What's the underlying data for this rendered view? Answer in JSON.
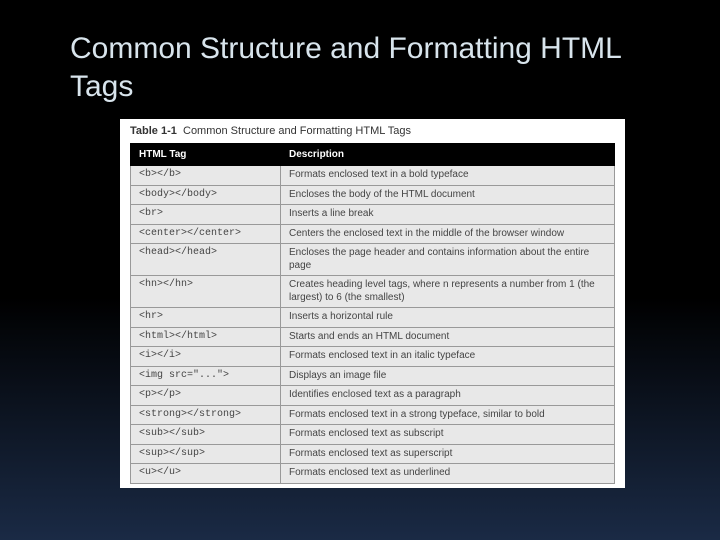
{
  "title": "Common Structure and Formatting HTML Tags",
  "caption": {
    "label": "Table 1-1",
    "text": "Common Structure and Formatting HTML Tags"
  },
  "headers": {
    "col1": "HTML Tag",
    "col2": "Description"
  },
  "rows": [
    {
      "tag": "<b></b>",
      "desc": "Formats enclosed text in a bold typeface"
    },
    {
      "tag": "<body></body>",
      "desc": "Encloses the body of the HTML document"
    },
    {
      "tag": "<br>",
      "desc": "Inserts a line break"
    },
    {
      "tag": "<center></center>",
      "desc": "Centers the enclosed text in the middle of the browser window"
    },
    {
      "tag": "<head></head>",
      "desc": "Encloses the page header and contains information about the entire page"
    },
    {
      "tag": "<hn></hn>",
      "desc": "Creates heading level tags, where n represents a number from 1 (the largest) to 6 (the smallest)"
    },
    {
      "tag": "<hr>",
      "desc": "Inserts a horizontal rule"
    },
    {
      "tag": "<html></html>",
      "desc": "Starts and ends an HTML document"
    },
    {
      "tag": "<i></i>",
      "desc": "Formats enclosed text in an italic typeface"
    },
    {
      "tag": "<img src=\"...\">",
      "desc": "Displays an image file"
    },
    {
      "tag": "<p></p>",
      "desc": "Identifies enclosed text as a paragraph"
    },
    {
      "tag": "<strong></strong>",
      "desc": "Formats enclosed text in a strong typeface, similar to bold"
    },
    {
      "tag": "<sub></sub>",
      "desc": "Formats enclosed text as subscript"
    },
    {
      "tag": "<sup></sup>",
      "desc": "Formats enclosed text as superscript"
    },
    {
      "tag": "<u></u>",
      "desc": "Formats enclosed text as underlined"
    }
  ]
}
